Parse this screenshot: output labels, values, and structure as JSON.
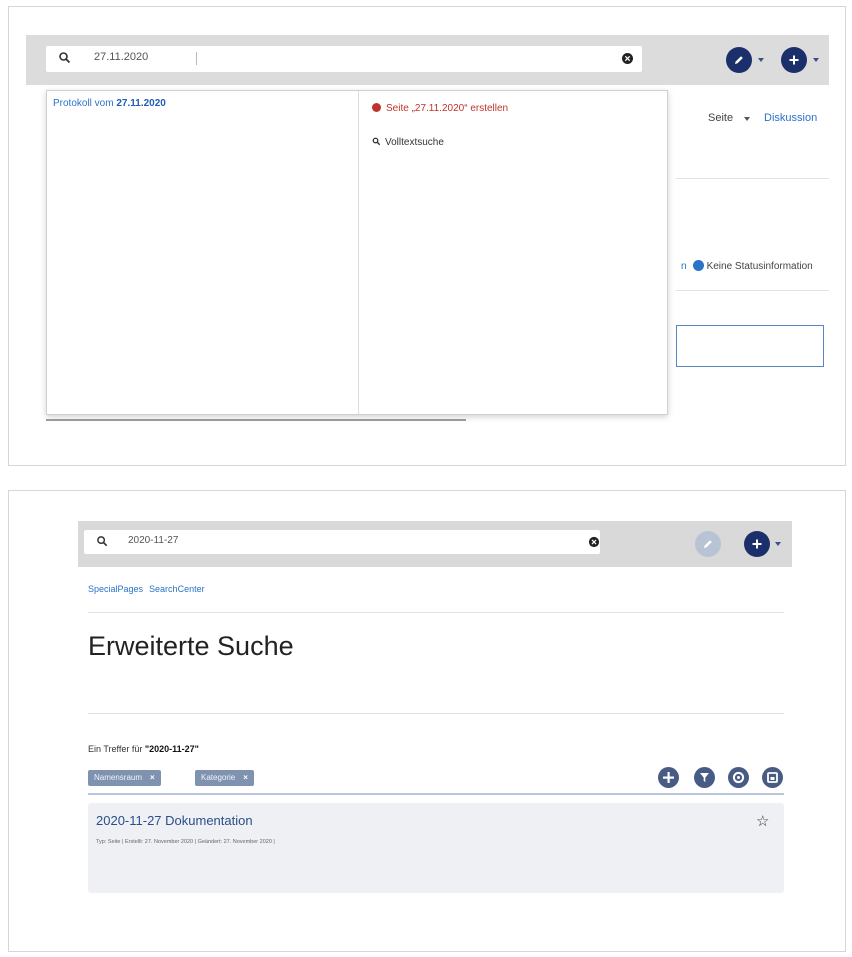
{
  "screenshot1": {
    "search": {
      "value": "27.11.2020"
    },
    "background": {
      "tab_page": "Seite",
      "tab_discussion": "Diskussion",
      "status_text": "Keine Statusinformation",
      "status_partial": "n"
    },
    "dropdown": {
      "result_prefix": "Protokoll vom ",
      "result_highlight": "27.11.2020",
      "create_page": "Seite „27.11.2020“ erstellen",
      "fulltext_search": "Volltextsuche"
    }
  },
  "screenshot2": {
    "search": {
      "value": "2020-11-27"
    },
    "breadcrumb": [
      "SpecialPages",
      "SearchCenter"
    ],
    "page_title": "Erweiterte Suche",
    "hits_prefix": "Ein Treffer für ",
    "hits_query": "\"2020-11-27\"",
    "filter_chips": [
      {
        "label": "Namensraum",
        "remove": "×"
      },
      {
        "label": "Kategorie",
        "remove": "×"
      }
    ],
    "tool_icons": [
      "add-icon",
      "filter-icon",
      "settings-icon",
      "export-icon"
    ],
    "result": {
      "title": "2020-11-27 Dokumentation",
      "meta": "Typ: Seite | Erstellt: 27. November 2020 | Geändert: 27. November 2020 |",
      "star": "☆"
    }
  },
  "colors": {
    "accent_blue": "#2a73c9",
    "dark_button": "#1b2f6b",
    "create_red": "#c0332b",
    "chip": "#7f93b1",
    "toolbar_gray": "#dcdcdc"
  }
}
